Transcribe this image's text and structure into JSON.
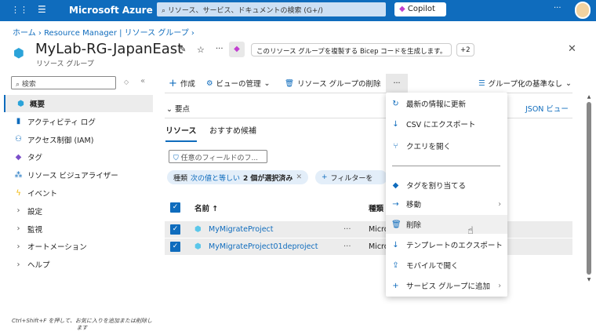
{
  "topbar": {
    "brand": "Microsoft Azure",
    "search_placeholder": "リソース、サービス、ドキュメントの検索 (G+/)",
    "copilot": "Copilot",
    "more": "···"
  },
  "breadcrumb": {
    "home": "ホーム",
    "rm": "Resource Manager | リソース グループ"
  },
  "header": {
    "title": "MyLab-RG-JapanEast",
    "subtitle": "リソース グループ",
    "copilot_suggestion": "このリソース グループを複製する Bicep コードを生成します。",
    "plus": "+2",
    "more": "···"
  },
  "sidebar": {
    "search_placeholder": "検索",
    "items": [
      {
        "label": "概要",
        "icon": "resource-group-icon"
      },
      {
        "label": "アクティビティ ログ",
        "icon": "log-icon"
      },
      {
        "label": "アクセス制御 (IAM)",
        "icon": "people-icon"
      },
      {
        "label": "タグ",
        "icon": "tag-icon"
      },
      {
        "label": "リソース ビジュアライザー",
        "icon": "visualizer-icon"
      },
      {
        "label": "イベント",
        "icon": "bolt-icon"
      },
      {
        "label": "設定",
        "icon": "chevron-right-icon"
      },
      {
        "label": "監視",
        "icon": "chevron-right-icon"
      },
      {
        "label": "オートメーション",
        "icon": "chevron-right-icon"
      },
      {
        "label": "ヘルプ",
        "icon": "chevron-right-icon"
      }
    ],
    "hint": "Ctrl+Shift+F を押して、お気に入りを追加または削除します"
  },
  "toolbar": {
    "create": "作成",
    "manage_view": "ビューの管理",
    "delete_rg": "リソース グループの削除",
    "more": "···",
    "group_by": "グループ化の基準なし"
  },
  "main": {
    "essentials": "要点",
    "json_view": "JSON ビュー",
    "tabs": [
      "リソース",
      "おすすめ候補"
    ],
    "filter_placeholder": "任意のフィールドのフ...",
    "filter_pill": {
      "field": "種類",
      "op": "次の値と等しい",
      "value": "2 個が選択済み"
    },
    "add_filter": "フィルターを",
    "columns": {
      "name": "名前 ↑",
      "type": "種類"
    },
    "rows": [
      {
        "name": "MyMigrateProject",
        "type": "Micro"
      },
      {
        "name": "MyMigrateProject01deproject",
        "type": "Micro"
      }
    ]
  },
  "menu": {
    "items": [
      {
        "label": "最新の情報に更新",
        "icon": "refresh-icon"
      },
      {
        "label": "CSV にエクスポート",
        "icon": "download-icon"
      },
      {
        "label": "クエリを開く",
        "icon": "query-icon"
      },
      {
        "label": "タグを割り当てる",
        "icon": "tag-icon"
      },
      {
        "label": "移動",
        "icon": "arrow-right-icon"
      },
      {
        "label": "削除",
        "icon": "trash-icon"
      },
      {
        "label": "テンプレートのエクスポート",
        "icon": "download-icon"
      },
      {
        "label": "モバイルで開く",
        "icon": "share-icon"
      },
      {
        "label": "サービス グループに追加",
        "icon": "plus-icon"
      }
    ]
  }
}
